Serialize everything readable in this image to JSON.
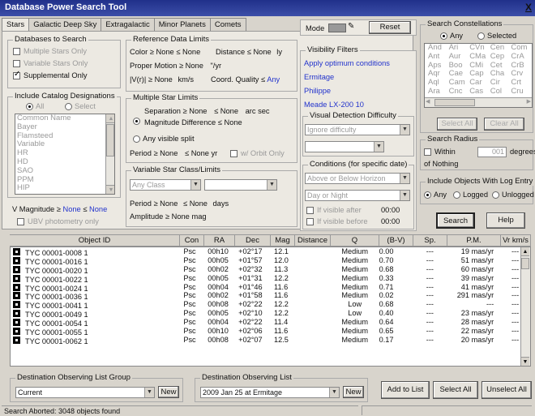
{
  "window": {
    "title": "Database Power Search Tool",
    "close_label": "X"
  },
  "tabs": [
    "Stars",
    "Galactic Deep Sky",
    "Extragalactic",
    "Minor Planets",
    "Comets"
  ],
  "databases": {
    "title": "Databases to Search",
    "items": [
      {
        "label": "Multiple Stars Only",
        "checked": false,
        "enabled": false
      },
      {
        "label": "Variable Stars Only",
        "checked": false,
        "enabled": false
      },
      {
        "label": "Supplemental Only",
        "checked": true,
        "enabled": true
      }
    ]
  },
  "catalog": {
    "title": "Include Catalog Designations",
    "radio_all": "All",
    "radio_select": "Select",
    "items": [
      "Common Name",
      "Bayer",
      "Flamsteed",
      "Variable",
      "HR",
      "HD",
      "SAO",
      "PPM",
      "HIP"
    ]
  },
  "vmag": {
    "label": "V Magnitude ≥",
    "min": "None",
    "sep": "≤",
    "max": "None"
  },
  "ubv": {
    "label": "UBV photometry only"
  },
  "ref_limits": {
    "title": "Reference Data Limits",
    "color": {
      "label": "Color ≥",
      "min": "None",
      "sep": "≤",
      "max": "None"
    },
    "distance": {
      "label": "Distance ≤",
      "value": "None",
      "unit": "ly"
    },
    "proper_motion": {
      "label": "Proper Motion ≥",
      "value": "None",
      "unit": "\"/yr"
    },
    "vr": {
      "label": "|V(r)| ≥",
      "value": "None",
      "unit": "km/s"
    },
    "coord_quality": {
      "label": "Coord. Quality ≤",
      "value": "Any"
    }
  },
  "multiple_star": {
    "title": "Multiple Star Limits",
    "separation": {
      "label": "Separation ≥",
      "min": "None",
      "sep": "≤",
      "max": "None",
      "unit": "arc sec"
    },
    "mag_diff": {
      "label": "Magnitude Difference ≤",
      "value": "None"
    },
    "any_visible": "Any visible split",
    "period": {
      "label": "Period ≥",
      "min": "None",
      "sep": "≤",
      "max": "None",
      "unit": "yr"
    },
    "orbit_only": "w/ Orbit Only"
  },
  "variable_star": {
    "title": "Variable Star Class/Limits",
    "class_value": "Any Class",
    "period": {
      "label": "Period ≥",
      "min": "None",
      "sep": "≤",
      "max": "None",
      "unit": "days"
    },
    "amplitude": {
      "label": "Amplitude ≥",
      "value": "None",
      "unit": "mag"
    }
  },
  "mode": {
    "label": "Mode",
    "reset": "Reset"
  },
  "visibility": {
    "title": "Visibility Filters",
    "items": [
      "Apply optimum conditions",
      "Ermitage",
      "Philippe",
      "Meade LX-200 10"
    ]
  },
  "difficulty": {
    "title": "Visual Detection Difficulty",
    "value": "Ignore difficulty",
    "value2": ""
  },
  "conditions": {
    "title": "Conditions (for specific date)",
    "horizon": "Above or Below Horizon",
    "daynight": "Day or Night",
    "after": {
      "label": "If visible after",
      "time": "00:00"
    },
    "before": {
      "label": "If visible before",
      "time": "00:00"
    }
  },
  "constellations": {
    "title": "Search Constellations",
    "radio_any": "Any",
    "radio_selected": "Selected",
    "rows": [
      [
        "And",
        "Ari",
        "CVn",
        "Cen",
        "Com"
      ],
      [
        "Ant",
        "Aur",
        "CMa",
        "Cep",
        "CrA"
      ],
      [
        "Aps",
        "Boo",
        "CMi",
        "Cet",
        "CrB"
      ],
      [
        "Aqr",
        "Cae",
        "Cap",
        "Cha",
        "Crv"
      ],
      [
        "Aql",
        "Cam",
        "Car",
        "Cir",
        "Crt"
      ],
      [
        "Ara",
        "Cnc",
        "Cas",
        "Col",
        "Cru"
      ]
    ],
    "select_all": "Select All",
    "clear_all": "Clear All"
  },
  "radius": {
    "title": "Search Radius",
    "within": "Within",
    "value": "001",
    "unit": "degrees",
    "of": "of Nothing"
  },
  "log_entry": {
    "title": "Include Objects With Log Entry",
    "options": [
      "Any",
      "Logged",
      "Unlogged"
    ]
  },
  "actions": {
    "search": "Search",
    "help": "Help"
  },
  "table": {
    "headers": [
      "Object ID",
      "Con",
      "RA",
      "Dec",
      "Mag",
      "Distance",
      "Q",
      "(B-V)",
      "Sp.",
      "P.M.",
      "Vr km/s"
    ],
    "rows": [
      [
        "TYC 00001-0008 1",
        "Psc",
        "00h10",
        "+02°17",
        "12.1",
        "",
        "Medium",
        "0.00",
        "---",
        "19 mas/yr",
        "---"
      ],
      [
        "TYC 00001-0016 1",
        "Psc",
        "00h05",
        "+01°57",
        "12.0",
        "",
        "Medium",
        "0.70",
        "---",
        "51 mas/yr",
        "---"
      ],
      [
        "TYC 00001-0020 1",
        "Psc",
        "00h02",
        "+02°32",
        "11.3",
        "",
        "Medium",
        "0.68",
        "---",
        "60 mas/yr",
        "---"
      ],
      [
        "TYC 00001-0022 1",
        "Psc",
        "00h05",
        "+01°31",
        "12.2",
        "",
        "Medium",
        "0.33",
        "---",
        "39 mas/yr",
        "---"
      ],
      [
        "TYC 00001-0024 1",
        "Psc",
        "00h04",
        "+01°46",
        "11.6",
        "",
        "Medium",
        "0.71",
        "---",
        "41 mas/yr",
        "---"
      ],
      [
        "TYC 00001-0036 1",
        "Psc",
        "00h02",
        "+01°58",
        "11.6",
        "",
        "Medium",
        "0.02",
        "---",
        "291 mas/yr",
        "---"
      ],
      [
        "TYC 00001-0041 1",
        "Psc",
        "00h08",
        "+02°22",
        "12.2",
        "",
        "Low",
        "0.68",
        "---",
        "---",
        "---"
      ],
      [
        "TYC 00001-0049 1",
        "Psc",
        "00h05",
        "+02°10",
        "12.2",
        "",
        "Low",
        "0.40",
        "---",
        "23 mas/yr",
        "---"
      ],
      [
        "TYC 00001-0054 1",
        "Psc",
        "00h04",
        "+02°22",
        "11.4",
        "",
        "Medium",
        "0.64",
        "---",
        "28 mas/yr",
        "---"
      ],
      [
        "TYC 00001-0055 1",
        "Psc",
        "00h10",
        "+02°06",
        "11.6",
        "",
        "Medium",
        "0.65",
        "---",
        "22 mas/yr",
        "---"
      ],
      [
        "TYC 00001-0062 1",
        "Psc",
        "00h08",
        "+02°07",
        "12.5",
        "",
        "Medium",
        "0.17",
        "---",
        "20 mas/yr",
        "---"
      ]
    ]
  },
  "dest_group": {
    "title": "Destination Observing List Group",
    "value": "Current",
    "new": "New"
  },
  "dest_list": {
    "title": "Destination Observing List",
    "value": "2009 Jan 25 at Ermitage",
    "new": "New"
  },
  "bottom_buttons": {
    "add": "Add to List",
    "select_all": "Select All",
    "unselect_all": "Unselect All"
  },
  "status": "Search Aborted: 3048 objects found"
}
